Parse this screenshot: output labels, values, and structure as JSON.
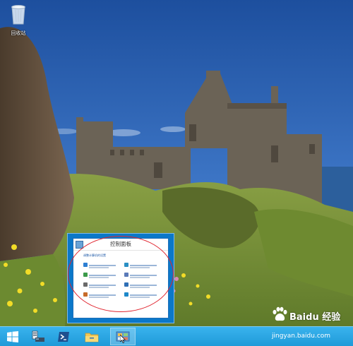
{
  "desktop": {
    "recycle_bin_label": "回收站"
  },
  "preview": {
    "title": "控制面板",
    "header": "调整计算机的设置"
  },
  "taskbar": {
    "items": [
      {
        "icon": "windows-start-icon"
      },
      {
        "icon": "server-manager-icon"
      },
      {
        "icon": "powershell-icon"
      },
      {
        "icon": "file-explorer-icon"
      },
      {
        "icon": "control-panel-icon"
      }
    ]
  },
  "watermark": {
    "brand_text": "Baidu 经验",
    "url": "jingyan.baidu.com"
  },
  "colors": {
    "taskbar": "#29a8e6",
    "annotation": "#e0242e",
    "preview_frame": "#0b78c9"
  }
}
